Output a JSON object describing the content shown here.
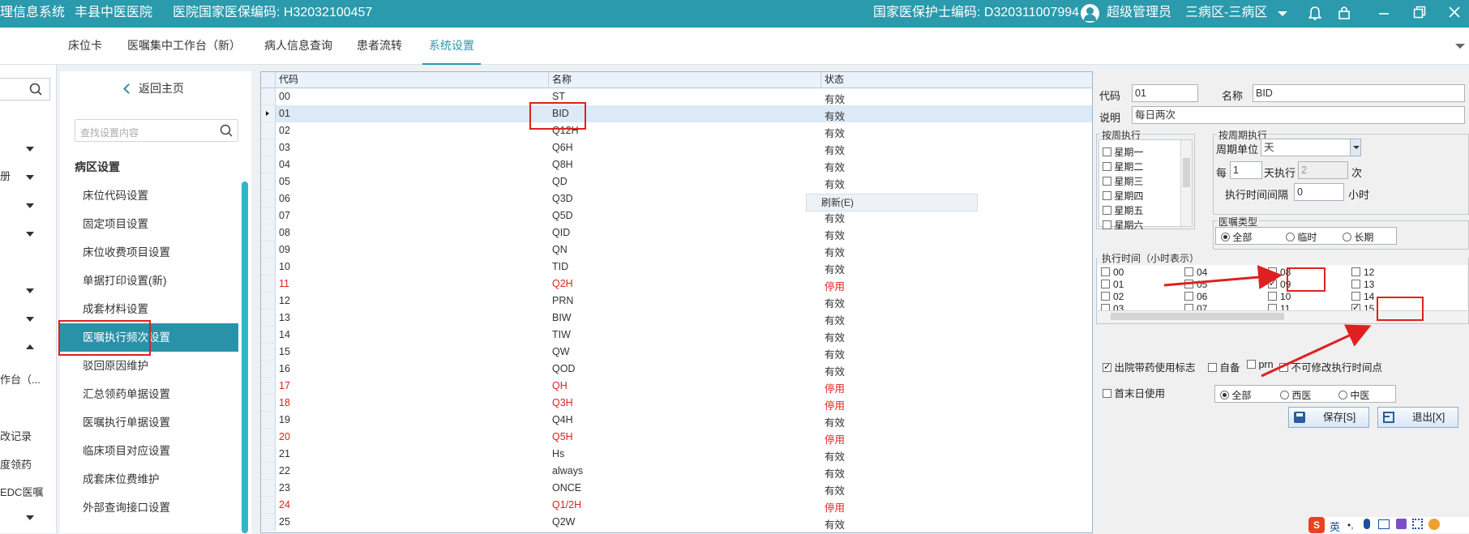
{
  "topbar": {
    "app_title": "理信息系统",
    "hospital": "丰县中医医院",
    "insurance_code": "医院国家医保编码: H32032100457",
    "nurse_code": "国家医保护士编码: D320311007994",
    "user": "超级管理员",
    "ward": "三病区-三病区"
  },
  "tabs": [
    "床位卡",
    "医嘱集中工作台（新）",
    "病人信息查询",
    "患者流转",
    "系统设置"
  ],
  "farleft": {
    "items": [
      "册",
      "作台（...",
      "改记录",
      "度领药",
      "EDC医嘱"
    ]
  },
  "nav": {
    "back_label": "返回主页",
    "search_placeholder": "查找设置内容",
    "section_title": "病区设置",
    "items": [
      "床位代码设置",
      "固定项目设置",
      "床位收费项目设置",
      "单据打印设置(新)",
      "成套材料设置",
      "医嘱执行频次设置",
      "驳回原因维护",
      "汇总领药单据设置",
      "医嘱执行单据设置",
      "临床项目对应设置",
      "成套床位费维护",
      "外部查询接口设置"
    ]
  },
  "grid": {
    "headers": [
      "代码",
      "名称",
      "状态"
    ],
    "rows": [
      {
        "code": "00",
        "name": "ST",
        "status": "有效"
      },
      {
        "code": "01",
        "name": "BID",
        "status": "有效"
      },
      {
        "code": "02",
        "name": "Q12H",
        "status": "有效"
      },
      {
        "code": "03",
        "name": "Q6H",
        "status": "有效"
      },
      {
        "code": "04",
        "name": "Q8H",
        "status": "有效"
      },
      {
        "code": "05",
        "name": "QD",
        "status": "有效"
      },
      {
        "code": "06",
        "name": "Q3D",
        "status": "有效"
      },
      {
        "code": "07",
        "name": "Q5D",
        "status": "有效"
      },
      {
        "code": "08",
        "name": "QID",
        "status": "有效"
      },
      {
        "code": "09",
        "name": "QN",
        "status": "有效"
      },
      {
        "code": "10",
        "name": "TID",
        "status": "有效"
      },
      {
        "code": "11",
        "name": "Q2H",
        "status": "停用"
      },
      {
        "code": "12",
        "name": "PRN",
        "status": "有效"
      },
      {
        "code": "13",
        "name": "BIW",
        "status": "有效"
      },
      {
        "code": "14",
        "name": "TIW",
        "status": "有效"
      },
      {
        "code": "15",
        "name": "QW",
        "status": "有效"
      },
      {
        "code": "16",
        "name": "QOD",
        "status": "有效"
      },
      {
        "code": "17",
        "name": "QH",
        "status": "停用"
      },
      {
        "code": "18",
        "name": "Q3H",
        "status": "停用"
      },
      {
        "code": "19",
        "name": "Q4H",
        "status": "有效"
      },
      {
        "code": "20",
        "name": "Q5H",
        "status": "停用"
      },
      {
        "code": "21",
        "name": "Hs",
        "status": "有效"
      },
      {
        "code": "22",
        "name": "always",
        "status": "有效"
      },
      {
        "code": "23",
        "name": "ONCE",
        "status": "有效"
      },
      {
        "code": "24",
        "name": "Q1/2H",
        "status": "停用"
      },
      {
        "code": "25",
        "name": "Q2W",
        "status": "有效"
      }
    ],
    "context_menu": "刷新(E)"
  },
  "detail": {
    "code_label": "代码",
    "code_value": "01",
    "name_label": "名称",
    "name_value": "BID",
    "desc_label": "说明",
    "desc_value": "每日两次",
    "weekly_title": "按周执行",
    "weekdays": [
      "星期一",
      "星期二",
      "星期三",
      "星期四",
      "星期五",
      "星期六"
    ],
    "period_title": "按周期执行",
    "period_unit_label": "周期单位",
    "period_unit_value": "天",
    "every_label": "每",
    "every_value": "1",
    "day_exec_label": "天执行",
    "day_exec_value": "2",
    "times_label": "次",
    "interval_label": "执行时间间隔",
    "interval_value": "0",
    "hours_label": "小时",
    "order_type_title": "医嘱类型",
    "order_types": [
      "全部",
      "临时",
      "长期"
    ],
    "exec_time_title": "执行时间（小时表示）",
    "hours": [
      "00",
      "01",
      "02",
      "03",
      "04",
      "05",
      "06",
      "07",
      "08",
      "09",
      "10",
      "11",
      "12",
      "13",
      "14",
      "15"
    ],
    "checked_hours": [
      "09",
      "15"
    ],
    "flag_discharge": "出院带药使用标志",
    "flag_self": "自备",
    "flag_prn": "prn",
    "flag_fixed": "不可修改执行时间点",
    "flag_first_last": "首末日使用",
    "med_types": [
      "全部",
      "西医",
      "中医"
    ],
    "save_label": "保存[S]",
    "exit_label": "退出[X]"
  },
  "ime": {
    "lang": "英"
  },
  "colors": {
    "topbar": "#2a9aac",
    "accent": "#2a92a8",
    "stopped": "#e02020",
    "annotation": "#e02020"
  }
}
